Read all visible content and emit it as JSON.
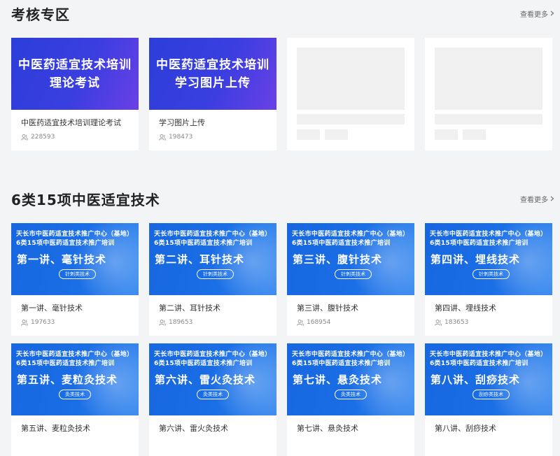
{
  "exam_section": {
    "title": "考核专区",
    "more": "查看更多",
    "cards": [
      {
        "thumb_text": [
          "中医药适宜技术培训",
          "理论考试"
        ],
        "title": "中医药适宜技术培训理论考试",
        "views": "228593"
      },
      {
        "thumb_text": [
          "中医药适宜技术培训",
          "学习图片上传"
        ],
        "title": "学习图片上传",
        "views": "198473"
      }
    ]
  },
  "tech_section": {
    "title": "6类15项中医适宜技术",
    "more": "查看更多",
    "thumb_line1": "天长市中医药适宜技术推广中心（基地）",
    "thumb_line2": "6类15项中医药适宜技术推广培训",
    "cards": [
      {
        "lecture": "第一讲、毫针技术",
        "tag": "针刺类技术",
        "title": "第一讲、毫针技术",
        "views": "197633"
      },
      {
        "lecture": "第二讲、耳针技术",
        "tag": "针刺类技术",
        "title": "第二讲、耳针技术",
        "views": "189653"
      },
      {
        "lecture": "第三讲、腹针技术",
        "tag": "针刺类技术",
        "title": "第三讲、腹针技术",
        "views": "168954"
      },
      {
        "lecture": "第四讲、埋线技术",
        "tag": "针刺类技术",
        "title": "第四讲、埋线技术",
        "views": "183653"
      },
      {
        "lecture": "第五讲、麦粒灸技术",
        "tag": "灸类技术",
        "title": "第五讲、麦粒灸技术",
        "views": ""
      },
      {
        "lecture": "第六讲、雷火灸技术",
        "tag": "灸类技术",
        "title": "第六讲、雷火灸技术",
        "views": ""
      },
      {
        "lecture": "第七讲、悬灸技术",
        "tag": "灸类技术",
        "title": "第七讲、悬灸技术",
        "views": ""
      },
      {
        "lecture": "第八讲、刮痧技术",
        "tag": "刮痧类技术",
        "title": "第八讲、刮痧技术",
        "views": ""
      }
    ]
  }
}
